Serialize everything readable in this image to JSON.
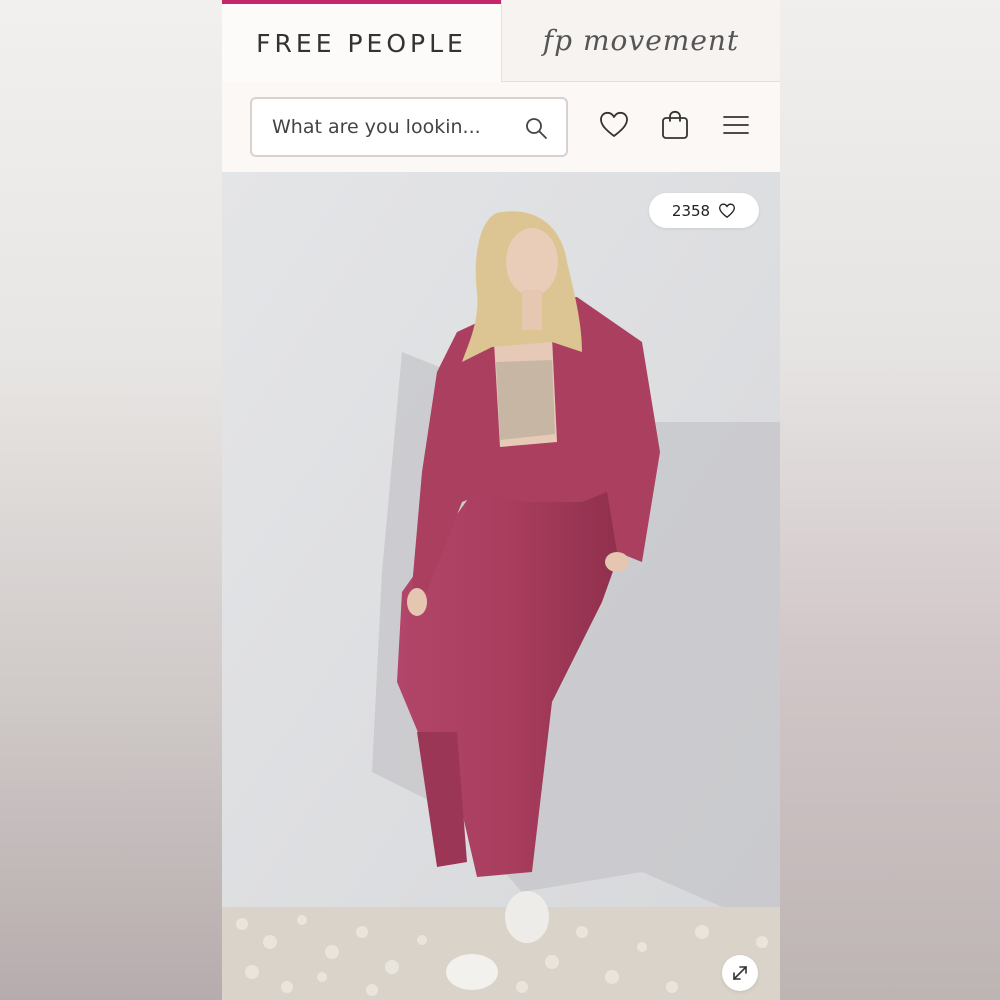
{
  "brand_tabs": {
    "free_people": "FREE PEOPLE",
    "fp_movement": "fp movement"
  },
  "header": {
    "search": {
      "placeholder": "What are you lookin..."
    },
    "icons": [
      "search-icon",
      "heart-icon",
      "bag-icon",
      "menu-icon"
    ]
  },
  "product": {
    "likes": "2358",
    "icons": [
      "heart-icon",
      "expand-icon"
    ]
  },
  "colors": {
    "accent": "#c4286b",
    "outfit": "#a83a5a"
  }
}
